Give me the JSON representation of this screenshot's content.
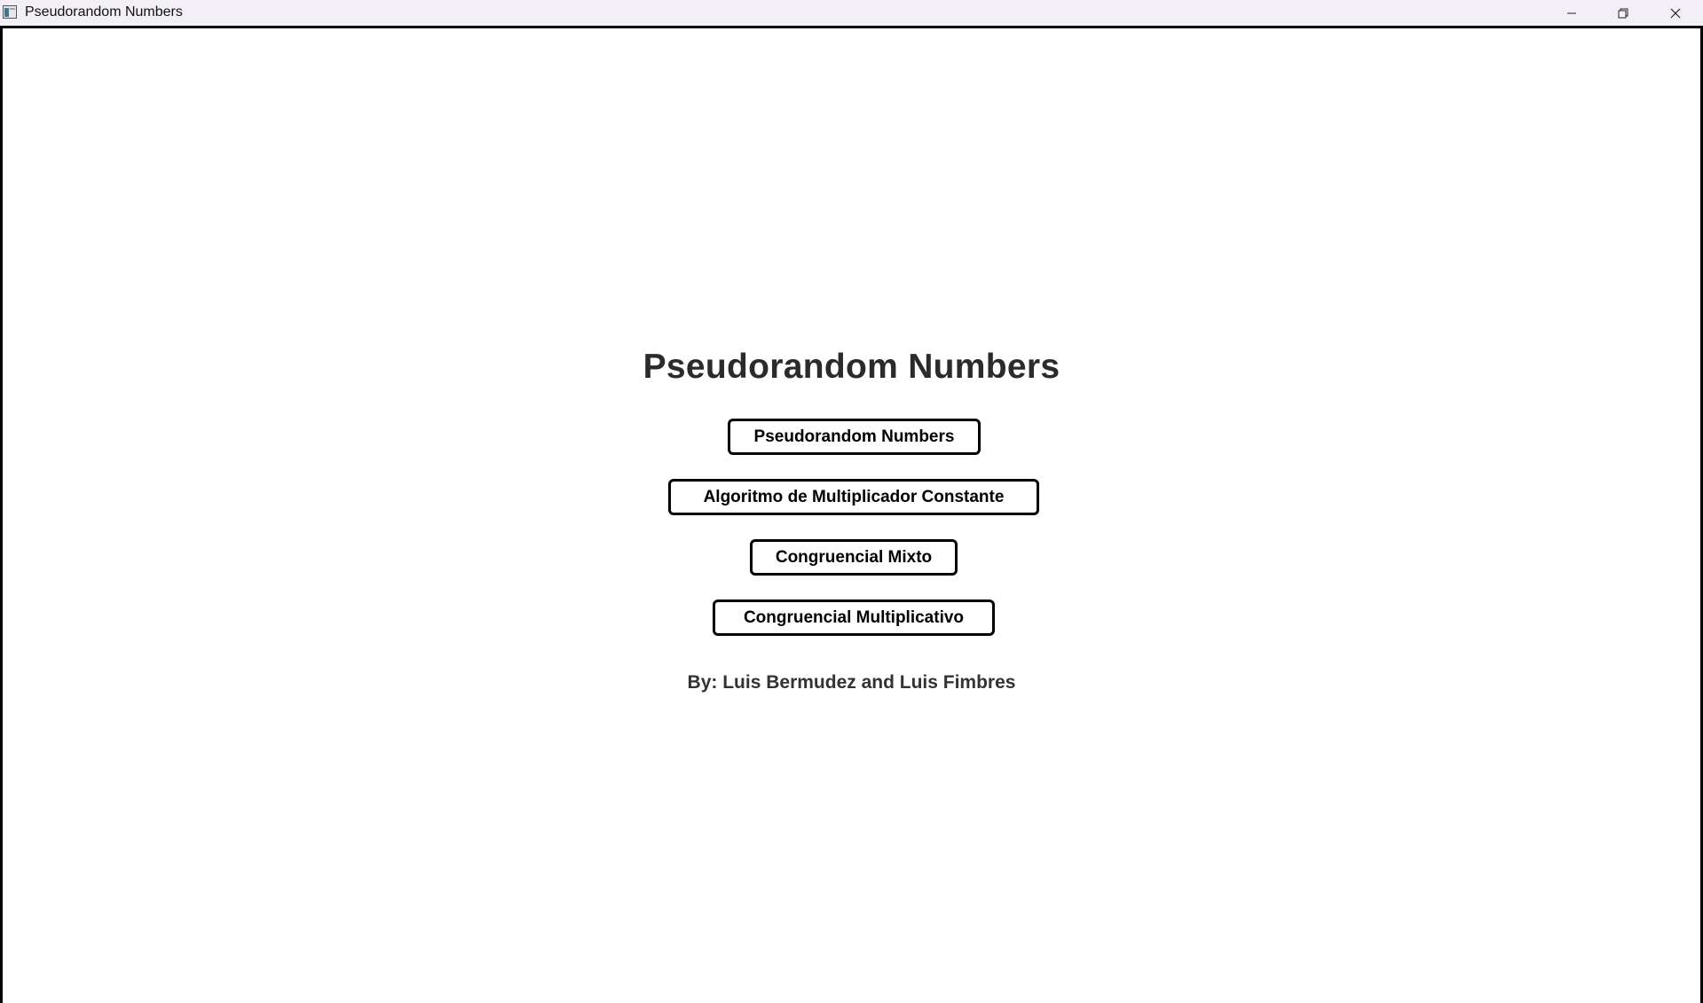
{
  "window": {
    "title": "Pseudorandom Numbers",
    "controls": {
      "minimize_icon": "minimize-icon",
      "maximize_icon": "restore-icon",
      "close_icon": "close-icon"
    }
  },
  "main": {
    "heading": "Pseudorandom Numbers",
    "buttons": [
      {
        "label": "Pseudorandom Numbers"
      },
      {
        "label": "Algoritmo de Multiplicador Constante"
      },
      {
        "label": "Congruencial Mixto"
      },
      {
        "label": "Congruencial Multiplicativo"
      }
    ],
    "credits": "By: Luis Bermudez and Luis Fimbres"
  },
  "colors": {
    "titlebar_bg": "#f3eff6",
    "heading_text": "#2b2b2b",
    "button_border": "#000000",
    "background": "#ffffff"
  }
}
